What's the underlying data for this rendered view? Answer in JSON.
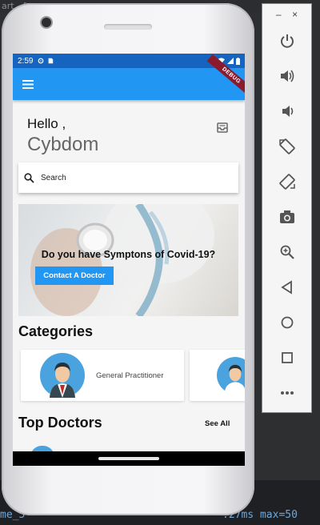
{
  "ide": {
    "title_fragment": "art - f",
    "status_left": "me_5",
    "status_mid": ":27ms max=50"
  },
  "statusbar": {
    "time": "2:59"
  },
  "appbar": {
    "menu_icon": "menu-icon",
    "debug_label": "DEBUG"
  },
  "greeting": {
    "hello": "Hello ,",
    "name": "Cybdom"
  },
  "search": {
    "placeholder": "Search"
  },
  "banner": {
    "title": "Do you have Symptons of Covid-19?",
    "button_label": "Contact A Doctor"
  },
  "categories": {
    "title": "Categories",
    "items": [
      {
        "label": "General Practitioner"
      },
      {
        "label": ""
      }
    ]
  },
  "top_doctors": {
    "title": "Top Doctors",
    "see_all": "See All"
  },
  "emulator": {
    "minimize": "–",
    "close": "×",
    "buttons": [
      "power-icon",
      "volume-up-icon",
      "volume-down-icon",
      "rotate-left-icon",
      "rotate-right-icon",
      "camera-icon",
      "zoom-icon",
      "back-icon",
      "home-icon",
      "overview-icon",
      "more-icon"
    ]
  },
  "colors": {
    "primary": "#2196f3",
    "status_bar": "#1565c0",
    "debug_ribbon": "#8b1a2e",
    "background": "#f5f5f5"
  }
}
